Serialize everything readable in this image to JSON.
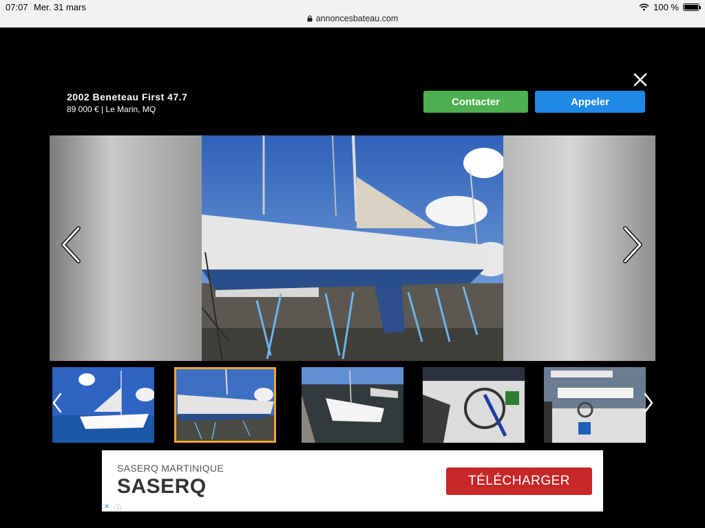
{
  "status": {
    "time": "07:07",
    "date": "Mer. 31 mars",
    "url": "annoncesbateau.com",
    "battery": "100 %"
  },
  "listing": {
    "title": "2002 Beneteau First 47.7",
    "subtitle": "89 000 €  |  Le Marin, MQ"
  },
  "actions": {
    "contact_label": "Contacter",
    "call_label": "Appeler"
  },
  "gallery": {
    "selected_index": 1,
    "thumb_count": 5
  },
  "ad": {
    "subtitle": "SASERQ MARTINIQUE",
    "title": "SASERQ",
    "cta_label": "TÉLÉCHARGER"
  },
  "colors": {
    "contact": "#4caf50",
    "call": "#1e88e5",
    "thumb_selected": "#f0a830",
    "ad_cta": "#c62828"
  }
}
